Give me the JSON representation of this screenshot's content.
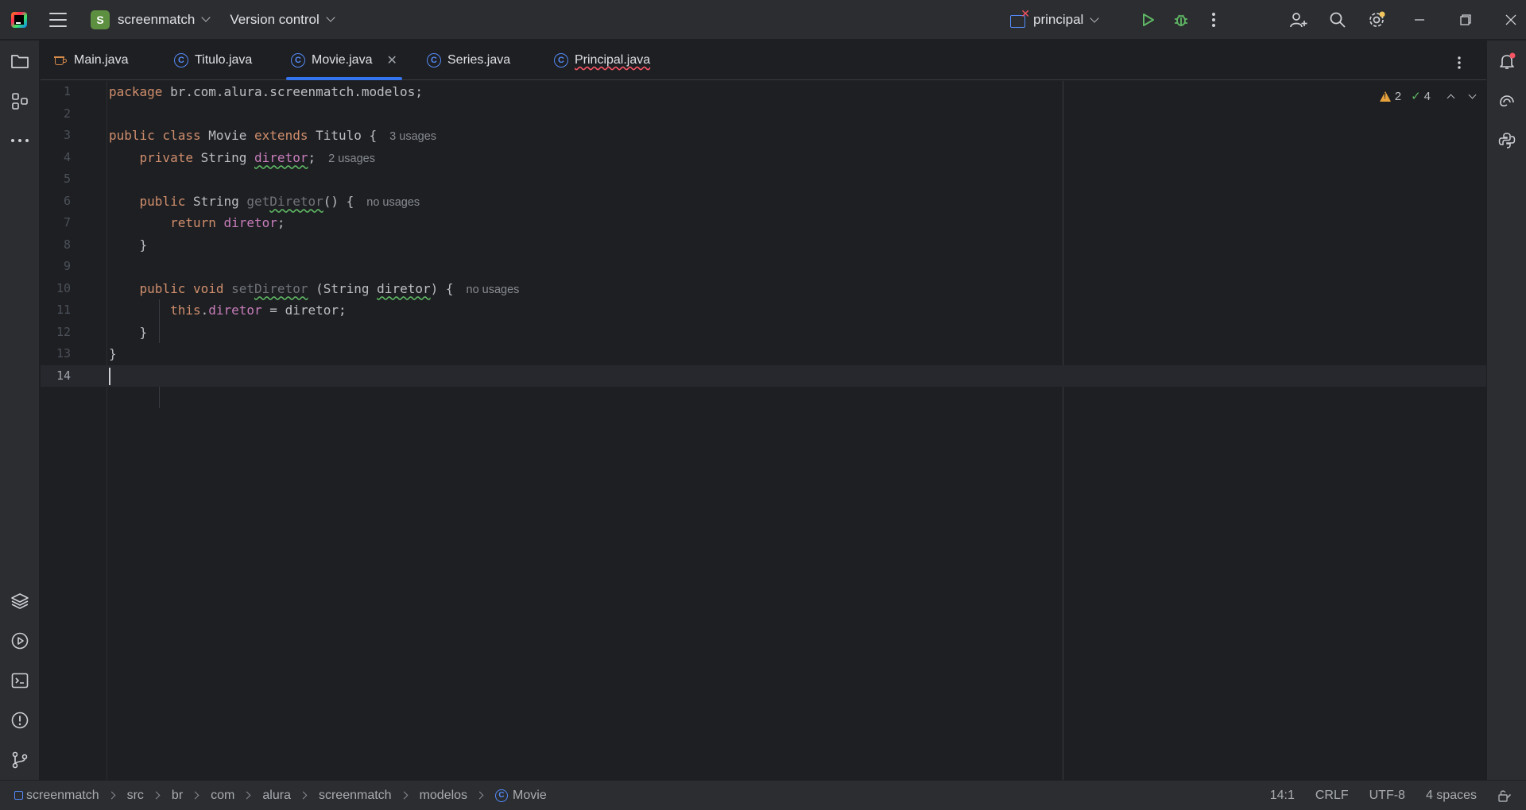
{
  "titlebar": {
    "project_initial": "S",
    "project_name": "screenmatch",
    "vcs_label": "Version control",
    "run_config": "principal"
  },
  "tabs": [
    {
      "label": "Main.java",
      "icon": "java-cup-icon",
      "active": false
    },
    {
      "label": "Titulo.java",
      "icon": "class-icon",
      "active": false
    },
    {
      "label": "Movie.java",
      "icon": "class-icon",
      "active": true
    },
    {
      "label": "Series.java",
      "icon": "class-icon",
      "active": false
    },
    {
      "label": "Principal.java",
      "icon": "runnable-class-icon",
      "active": false
    }
  ],
  "editor": {
    "lines": [
      {
        "n": "1"
      },
      {
        "n": "2"
      },
      {
        "n": "3"
      },
      {
        "n": "4"
      },
      {
        "n": "5"
      },
      {
        "n": "6"
      },
      {
        "n": "7"
      },
      {
        "n": "8"
      },
      {
        "n": "9"
      },
      {
        "n": "10"
      },
      {
        "n": "11"
      },
      {
        "n": "12"
      },
      {
        "n": "13"
      },
      {
        "n": "14"
      }
    ],
    "code": {
      "l1_kw": "package",
      "l1_rest": " br.com.alura.screenmatch.modelos;",
      "l3_kw1": "public class",
      "l3_name": " Movie ",
      "l3_kw2": "extends",
      "l3_rest": " Titulo {",
      "l3_hint": "3 usages",
      "l4_kw": "private",
      "l4_type": " String ",
      "l4_field": "diretor",
      "l4_end": ";",
      "l4_hint": "2 usages",
      "l6_kw": "public",
      "l6_type": " String ",
      "l6_name_a": "get",
      "l6_name_b": "Diretor",
      "l6_end": "() {",
      "l6_hint": "no usages",
      "l7_kw": "return",
      "l7_field": " diretor",
      "l7_end": ";",
      "l8": "}",
      "l10_kw": "public void",
      "l10_name_a": " set",
      "l10_name_b": "Diretor",
      "l10_mid": " (String ",
      "l10_param": "diretor",
      "l10_end": ") {",
      "l10_hint": "no usages",
      "l11_kw": "this",
      "l11_dot": ".",
      "l11_field": "diretor",
      "l11_end": " = diretor;",
      "l12": "}",
      "l13": "}"
    },
    "warnings": "2",
    "ok_count": "4"
  },
  "statusbar": {
    "breadcrumb": [
      "screenmatch",
      "src",
      "br",
      "com",
      "alura",
      "screenmatch",
      "modelos",
      "Movie"
    ],
    "position": "14:1",
    "line_ending": "CRLF",
    "encoding": "UTF-8",
    "indent": "4 spaces"
  },
  "colors": {
    "accent": "#3574f0",
    "keyword": "#cf8e6d",
    "field": "#c77dbb",
    "background": "#1e1f22",
    "panel": "#2b2d30"
  }
}
